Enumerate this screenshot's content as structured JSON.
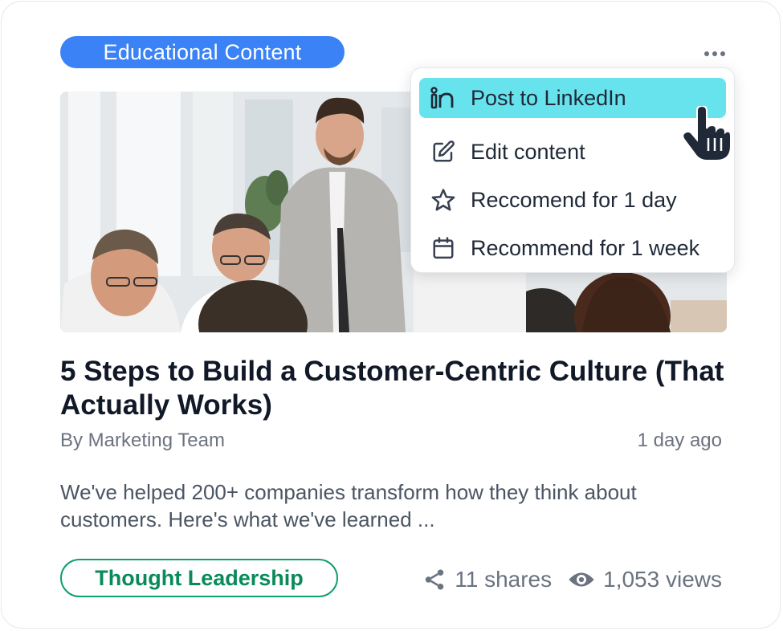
{
  "card": {
    "category": "Educational Content",
    "title": "5 Steps to Build a Customer-Centric Culture (That Actually Works)",
    "author": "By Marketing Team",
    "time": "1 day ago",
    "excerpt": "We've helped 200+ companies transform how they think about customers. Here's what we've learned ...",
    "tag": "Thought Leadership",
    "shares": "11 shares",
    "views": "1,053 views"
  },
  "menu": {
    "items": [
      {
        "label": "Post to LinkedIn",
        "icon": "linkedin-icon"
      },
      {
        "label": "Edit content",
        "icon": "edit-icon"
      },
      {
        "label": "Reccomend for 1 day",
        "icon": "star-icon"
      },
      {
        "label": "Recommend for 1 week",
        "icon": "calendar-icon"
      }
    ]
  },
  "colors": {
    "badge": "#3b82f6",
    "tag": "#10a06a",
    "menu_highlight": "#67e3ee",
    "title": "#111827",
    "muted": "#6b7280"
  }
}
